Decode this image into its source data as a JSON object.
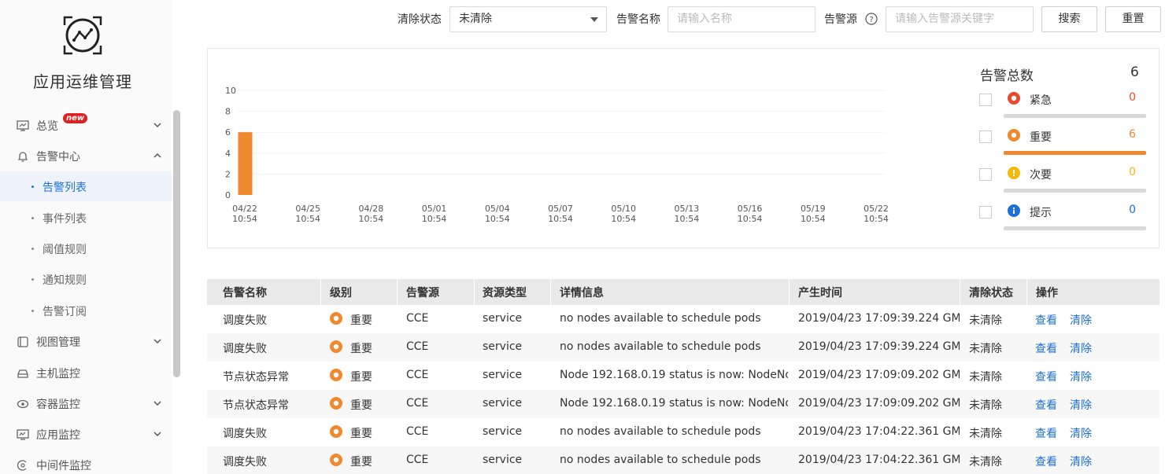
{
  "app": {
    "title": "应用运维管理"
  },
  "sidebar": {
    "items": [
      {
        "label": "总览",
        "badge": "new",
        "icon": "monitor-icon",
        "expanded": false
      },
      {
        "label": "告警中心",
        "icon": "bell-icon",
        "expanded": true,
        "children": [
          "告警列表",
          "事件列表",
          "阈值规则",
          "通知规则",
          "告警订阅"
        ],
        "active_child": "告警列表"
      },
      {
        "label": "视图管理",
        "icon": "view-icon",
        "expanded": false
      },
      {
        "label": "主机监控",
        "icon": "host-icon"
      },
      {
        "label": "容器监控",
        "icon": "container-icon",
        "expanded": false
      },
      {
        "label": "应用监控",
        "icon": "app-monitor-icon",
        "expanded": false
      },
      {
        "label": "中间件监控",
        "icon": "middleware-icon"
      }
    ]
  },
  "filters": {
    "clear_status_label": "清除状态",
    "clear_status_value": "未清除",
    "alarm_name_label": "告警名称",
    "alarm_name_placeholder": "请输入名称",
    "alarm_source_label": "告警源",
    "alarm_source_placeholder": "请输入告警源关键字",
    "search_button": "搜索",
    "reset_button": "重置"
  },
  "chart_data": {
    "type": "bar",
    "categories": [
      "04/22\n10:54",
      "04/25\n10:54",
      "04/28\n10:54",
      "05/01\n10:54",
      "05/04\n10:54",
      "05/07\n10:54",
      "05/10\n10:54",
      "05/13\n10:54",
      "05/16\n10:54",
      "05/19\n10:54",
      "05/22\n10:54"
    ],
    "x_ticks": [
      [
        "04/22",
        "10:54"
      ],
      [
        "04/25",
        "10:54"
      ],
      [
        "04/28",
        "10:54"
      ],
      [
        "05/01",
        "10:54"
      ],
      [
        "05/04",
        "10:54"
      ],
      [
        "05/07",
        "10:54"
      ],
      [
        "05/10",
        "10:54"
      ],
      [
        "05/13",
        "10:54"
      ],
      [
        "05/16",
        "10:54"
      ],
      [
        "05/19",
        "10:54"
      ],
      [
        "05/22",
        "10:54"
      ]
    ],
    "series": [
      {
        "values": [
          6,
          0,
          0,
          0,
          0,
          0,
          0,
          0,
          0,
          0,
          0
        ],
        "color": "#f0892d"
      }
    ],
    "y_ticks": [
      0,
      2,
      4,
      6,
      8,
      10
    ],
    "ylim": [
      0,
      10
    ],
    "grid": true
  },
  "legend": {
    "title": "告警总数",
    "total": "6",
    "items": [
      {
        "label": "紧急",
        "count": "0",
        "fraction": 0,
        "color": "#e8492f",
        "icon": "critical-icon"
      },
      {
        "label": "重要",
        "count": "6",
        "fraction": 1,
        "color": "#f0892d",
        "icon": "major-icon"
      },
      {
        "label": "次要",
        "count": "0",
        "fraction": 0,
        "color": "#f5b90e",
        "icon": "minor-icon"
      },
      {
        "label": "提示",
        "count": "0",
        "fraction": 0,
        "color": "#1e6fd9",
        "icon": "info-icon"
      }
    ]
  },
  "table": {
    "headers": [
      "告警名称",
      "级别",
      "告警源",
      "资源类型",
      "详情信息",
      "产生时间",
      "清除状态",
      "操作"
    ],
    "rows": [
      {
        "name": "调度失败",
        "level": "重要",
        "source": "CCE",
        "resource": "service",
        "detail": "no nodes available to schedule pods",
        "time": "2019/04/23 17:09:39.224 GM...",
        "status": "未清除",
        "view": "查看",
        "clear": "清除"
      },
      {
        "name": "调度失败",
        "level": "重要",
        "source": "CCE",
        "resource": "service",
        "detail": "no nodes available to schedule pods",
        "time": "2019/04/23 17:09:39.224 GM...",
        "status": "未清除",
        "view": "查看",
        "clear": "清除"
      },
      {
        "name": "节点状态异常",
        "level": "重要",
        "source": "CCE",
        "resource": "service",
        "detail": "Node 192.168.0.19 status is now: NodeNot...",
        "time": "2019/04/23 17:09:09.202 GM...",
        "status": "未清除",
        "view": "查看",
        "clear": "清除"
      },
      {
        "name": "节点状态异常",
        "level": "重要",
        "source": "CCE",
        "resource": "service",
        "detail": "Node 192.168.0.19 status is now: NodeNot...",
        "time": "2019/04/23 17:09:09.202 GM...",
        "status": "未清除",
        "view": "查看",
        "clear": "清除"
      },
      {
        "name": "调度失败",
        "level": "重要",
        "source": "CCE",
        "resource": "service",
        "detail": "no nodes available to schedule pods",
        "time": "2019/04/23 17:04:22.361 GM...",
        "status": "未清除",
        "view": "查看",
        "clear": "清除"
      },
      {
        "name": "调度失败",
        "level": "重要",
        "source": "CCE",
        "resource": "service",
        "detail": "no nodes available to schedule pods",
        "time": "2019/04/23 17:04:22.361 GM...",
        "status": "未清除",
        "view": "查看",
        "clear": "清除"
      }
    ]
  }
}
